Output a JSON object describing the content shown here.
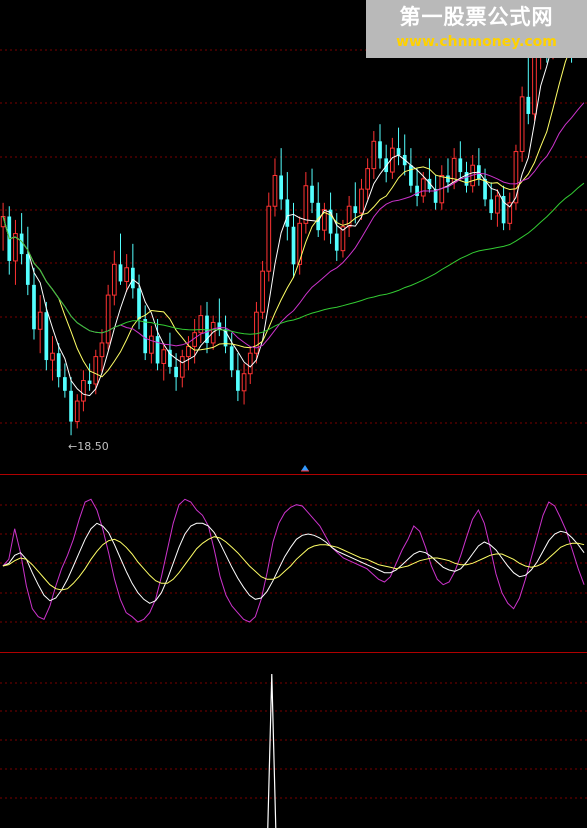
{
  "watermark": {
    "line1": "第一股票公式网",
    "line2": "www.chnmoney.com"
  },
  "chart_data": {
    "type": "candlestick",
    "low_marker": {
      "label": "←18.50",
      "value": 18.5,
      "bar_index": 11
    },
    "price_panel": {
      "candles": [
        [
          24.6,
          25.3,
          23.9,
          24.9
        ],
        [
          24.9,
          25.2,
          23.2,
          23.6
        ],
        [
          23.6,
          24.8,
          22.9,
          24.4
        ],
        [
          24.4,
          25.0,
          23.5,
          23.8
        ],
        [
          23.8,
          24.6,
          22.6,
          22.9
        ],
        [
          22.9,
          23.4,
          21.3,
          21.6
        ],
        [
          21.6,
          22.6,
          20.9,
          22.1
        ],
        [
          22.1,
          22.4,
          20.4,
          20.7
        ],
        [
          20.7,
          21.4,
          20.1,
          20.9
        ],
        [
          20.9,
          21.2,
          19.9,
          20.2
        ],
        [
          20.2,
          20.6,
          19.6,
          19.8
        ],
        [
          19.8,
          20.2,
          18.5,
          18.9
        ],
        [
          18.9,
          19.7,
          18.7,
          19.5
        ],
        [
          19.5,
          20.4,
          19.2,
          20.1
        ],
        [
          20.1,
          20.6,
          19.8,
          20.0
        ],
        [
          20.0,
          21.0,
          19.7,
          20.8
        ],
        [
          20.8,
          21.6,
          20.3,
          21.2
        ],
        [
          21.2,
          22.9,
          21.0,
          22.6
        ],
        [
          22.6,
          23.9,
          22.3,
          23.5
        ],
        [
          23.5,
          24.4,
          22.9,
          23.0
        ],
        [
          23.0,
          23.8,
          22.7,
          23.4
        ],
        [
          23.4,
          24.1,
          22.5,
          22.8
        ],
        [
          22.8,
          23.2,
          21.6,
          21.9
        ],
        [
          21.9,
          22.3,
          20.7,
          20.9
        ],
        [
          20.9,
          21.7,
          20.6,
          21.4
        ],
        [
          21.4,
          21.9,
          20.4,
          20.6
        ],
        [
          20.6,
          21.2,
          20.1,
          21.0
        ],
        [
          21.0,
          21.5,
          20.3,
          20.5
        ],
        [
          20.5,
          20.9,
          19.8,
          20.2
        ],
        [
          20.2,
          21.0,
          19.9,
          20.8
        ],
        [
          20.8,
          21.4,
          20.4,
          21.1
        ],
        [
          21.1,
          21.9,
          20.6,
          21.5
        ],
        [
          21.5,
          22.3,
          21.2,
          22.0
        ],
        [
          22.0,
          22.4,
          20.9,
          21.2
        ],
        [
          21.2,
          22.0,
          21.0,
          21.8
        ],
        [
          21.8,
          22.5,
          21.4,
          21.6
        ],
        [
          21.6,
          22.0,
          20.9,
          21.1
        ],
        [
          21.1,
          21.5,
          20.2,
          20.4
        ],
        [
          20.4,
          20.9,
          19.5,
          19.8
        ],
        [
          19.8,
          20.6,
          19.4,
          20.3
        ],
        [
          20.3,
          21.1,
          20.0,
          20.9
        ],
        [
          20.9,
          22.4,
          20.6,
          22.1
        ],
        [
          22.1,
          23.6,
          21.9,
          23.3
        ],
        [
          23.3,
          25.6,
          23.0,
          25.2
        ],
        [
          25.2,
          26.6,
          24.9,
          26.1
        ],
        [
          26.1,
          26.9,
          25.1,
          25.4
        ],
        [
          25.4,
          26.2,
          24.2,
          24.6
        ],
        [
          24.6,
          25.3,
          23.1,
          23.5
        ],
        [
          23.5,
          24.9,
          23.2,
          24.7
        ],
        [
          24.7,
          26.2,
          24.4,
          25.8
        ],
        [
          25.8,
          26.3,
          25.0,
          25.3
        ],
        [
          25.3,
          25.9,
          24.3,
          24.5
        ],
        [
          24.5,
          25.3,
          24.2,
          25.1
        ],
        [
          25.1,
          25.6,
          24.1,
          24.4
        ],
        [
          24.4,
          25.0,
          23.6,
          23.9
        ],
        [
          23.9,
          24.8,
          23.7,
          24.6
        ],
        [
          24.6,
          25.5,
          24.3,
          25.2
        ],
        [
          25.2,
          25.9,
          24.7,
          25.0
        ],
        [
          25.0,
          26.0,
          24.8,
          25.7
        ],
        [
          25.7,
          26.6,
          25.4,
          26.3
        ],
        [
          26.3,
          27.4,
          26.0,
          27.1
        ],
        [
          27.1,
          27.6,
          26.3,
          26.6
        ],
        [
          26.6,
          27.0,
          25.9,
          26.2
        ],
        [
          26.2,
          27.2,
          26.0,
          26.9
        ],
        [
          26.9,
          27.5,
          26.4,
          26.7
        ],
        [
          26.7,
          27.3,
          26.1,
          26.4
        ],
        [
          26.4,
          26.9,
          25.6,
          25.8
        ],
        [
          25.8,
          26.3,
          25.2,
          25.5
        ],
        [
          25.5,
          26.2,
          25.3,
          26.0
        ],
        [
          26.0,
          26.6,
          25.6,
          25.7
        ],
        [
          25.7,
          26.1,
          25.1,
          25.3
        ],
        [
          25.3,
          26.4,
          25.1,
          26.1
        ],
        [
          26.1,
          26.6,
          25.6,
          25.9
        ],
        [
          25.9,
          26.9,
          25.7,
          26.6
        ],
        [
          26.6,
          27.1,
          26.0,
          26.2
        ],
        [
          26.2,
          26.5,
          25.6,
          25.8
        ],
        [
          25.8,
          26.7,
          25.6,
          26.4
        ],
        [
          26.4,
          26.9,
          25.8,
          26.0
        ],
        [
          26.0,
          26.3,
          25.2,
          25.4
        ],
        [
          25.4,
          25.9,
          24.8,
          25.0
        ],
        [
          25.0,
          25.7,
          24.6,
          25.5
        ],
        [
          25.5,
          25.8,
          24.5,
          24.7
        ],
        [
          24.7,
          25.6,
          24.5,
          25.3
        ],
        [
          25.3,
          27.0,
          25.1,
          26.8
        ],
        [
          26.8,
          28.7,
          26.5,
          28.4
        ],
        [
          28.4,
          29.6,
          27.6,
          27.9
        ],
        [
          27.9,
          30.1,
          27.7,
          29.8
        ],
        [
          29.8,
          31.4,
          29.2,
          30.7
        ],
        [
          30.7,
          31.2,
          29.4,
          29.7
        ],
        [
          29.7,
          32.2,
          29.5,
          31.8
        ],
        [
          31.8,
          33.4,
          31.0,
          32.6
        ],
        [
          32.6,
          32.9,
          30.9,
          31.3
        ],
        [
          31.3,
          32.4,
          29.4,
          29.9
        ],
        [
          29.9,
          31.6,
          29.7,
          31.2
        ],
        [
          31.2,
          31.9,
          30.0,
          30.4
        ]
      ],
      "moving_averages": [
        {
          "color": "#ffffff",
          "period": 5
        },
        {
          "color": "#ffff66",
          "period": 10
        },
        {
          "color": "#cc33cc",
          "period": 20
        },
        {
          "color": "#33cc33",
          "period": 60
        }
      ],
      "up_color": "#ff3333",
      "down_color": "#54ffff",
      "ylim": [
        17.6,
        31.0
      ]
    },
    "oscillator_panel": {
      "ylim": [
        -10,
        110
      ],
      "series": [
        {
          "color": "#cc33cc",
          "values": [
            50,
            55,
            78,
            60,
            35,
            18,
            12,
            10,
            20,
            35,
            48,
            58,
            70,
            85,
            98,
            100,
            92,
            78,
            60,
            40,
            25,
            15,
            12,
            8,
            10,
            15,
            25,
            42,
            62,
            82,
            96,
            100,
            98,
            92,
            88,
            80,
            62,
            42,
            28,
            20,
            15,
            10,
            8,
            12,
            25,
            45,
            68,
            82,
            90,
            94,
            96,
            95,
            90,
            85,
            80,
            72,
            64,
            60,
            56,
            54,
            52,
            50,
            48,
            44,
            40,
            38,
            42,
            52,
            62,
            70,
            80,
            76,
            64,
            50,
            40,
            36,
            38,
            46,
            58,
            72,
            85,
            92,
            82,
            64,
            44,
            30,
            22,
            18,
            26,
            40,
            56,
            72,
            88,
            98,
            95,
            86,
            76,
            62,
            48,
            36
          ]
        },
        {
          "color": "#ffffff",
          "values": [
            50,
            52,
            58,
            60,
            55,
            45,
            36,
            28,
            24,
            26,
            32,
            40,
            50,
            60,
            70,
            78,
            82,
            80,
            75,
            66,
            56,
            46,
            37,
            30,
            25,
            22,
            24,
            30,
            40,
            52,
            64,
            74,
            80,
            82,
            82,
            80,
            75,
            67,
            58,
            49,
            41,
            34,
            28,
            25,
            26,
            31,
            39,
            48,
            57,
            64,
            70,
            73,
            74,
            73,
            71,
            68,
            64,
            61,
            59,
            57,
            55,
            53,
            51,
            49,
            47,
            45,
            45,
            47,
            51,
            55,
            59,
            61,
            60,
            57,
            53,
            49,
            47,
            46,
            48,
            53,
            59,
            65,
            68,
            66,
            62,
            56,
            50,
            45,
            42,
            43,
            47,
            53,
            61,
            69,
            74,
            76,
            75,
            71,
            66,
            60
          ]
        },
        {
          "color": "#ffff66",
          "values": [
            50,
            51,
            54,
            56,
            55,
            51,
            46,
            41,
            36,
            33,
            32,
            33,
            37,
            42,
            48,
            55,
            61,
            66,
            69,
            70,
            68,
            64,
            59,
            53,
            48,
            43,
            39,
            37,
            37,
            40,
            45,
            51,
            57,
            63,
            67,
            70,
            72,
            71,
            68,
            64,
            60,
            55,
            50,
            46,
            42,
            40,
            40,
            42,
            46,
            50,
            55,
            59,
            63,
            65,
            66,
            66,
            65,
            64,
            62,
            60,
            58,
            56,
            55,
            53,
            51,
            50,
            49,
            48,
            49,
            50,
            52,
            54,
            55,
            56,
            56,
            55,
            54,
            52,
            51,
            51,
            52,
            54,
            56,
            58,
            59,
            59,
            57,
            55,
            52,
            50,
            49,
            50,
            52,
            56,
            60,
            64,
            66,
            67,
            67,
            66
          ]
        }
      ]
    },
    "signal_panel": {
      "ylim": [
        0,
        100
      ],
      "spike": {
        "bar_index": 43,
        "value": 100
      }
    }
  }
}
